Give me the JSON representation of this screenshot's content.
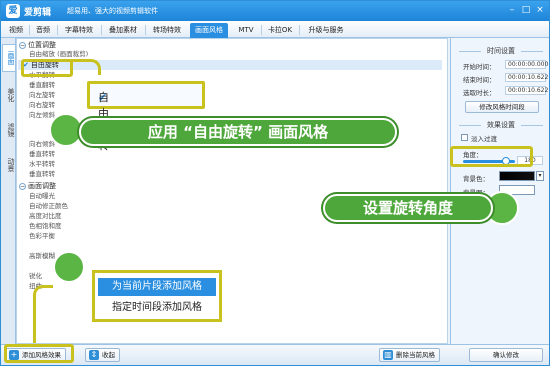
{
  "titlebar": {
    "logo": "爱",
    "app_name": "爱剪辑",
    "slogan": "超易用、强大的视频剪辑软件",
    "controls": [
      "–",
      "□",
      "×"
    ]
  },
  "tabs": [
    "视频",
    "音频",
    "字幕特效",
    "叠加素材",
    "转场特效",
    "画面风格",
    "MTV",
    "卡拉OK",
    "升级与服务"
  ],
  "active_tab": "画面风格",
  "vertical_tabs": [
    "画面",
    "美化",
    "滤镜",
    "动景"
  ],
  "list": {
    "section1_title": "位置调整",
    "section1_items_above": [
      "自由缩放 (画面裁剪)"
    ],
    "selected_item": "自由旋转",
    "section1_items_below": [
      "水平翻转",
      "垂直翻转",
      "向左旋转",
      "向右旋转",
      "向左倾斜",
      "向右倾斜",
      "垂直转转",
      "水平转转",
      "垂直转转"
    ],
    "section2_title": "画面调整",
    "section2_items": [
      "自动曝光",
      "自动修正颜色",
      "高度对比度",
      "色相饱和度",
      "色彩平衡",
      "高斯模糊",
      "锐化",
      "扭曲"
    ]
  },
  "callout": {
    "box_label": "自由旋转",
    "banner_top": "应用 “自由旋转” 画面风格",
    "banner_right": "设置旋转角度"
  },
  "context_menu": [
    "为当前片段添加风格",
    "指定时间段添加风格"
  ],
  "bottombar": {
    "add_style": "添加风格效果",
    "collapse": "收起",
    "delete_style": "删除当前风格",
    "confirm": "确认修改"
  },
  "right_panel": {
    "time_header": "时间设置",
    "start_label": "开始时间：",
    "start_value": "00:00:00.000",
    "end_label": "结束时间：",
    "end_value": "00:00:10.622",
    "duration_label": "选取时长：",
    "duration_value": "00:00:10.622",
    "modify_time_button": "修改风格时间段",
    "effect_header": "效果设置",
    "fade_label": "淡入过渡",
    "angle_label": "角度：",
    "angle_value": "180",
    "angle_fraction": 0.82,
    "bg_color_label": "背景色：",
    "bg_image_label": "背景图："
  },
  "colors": {
    "accent": "#2a8fe0",
    "highlight_border": "#c9c21e",
    "banner_green": "#4ea73a"
  }
}
